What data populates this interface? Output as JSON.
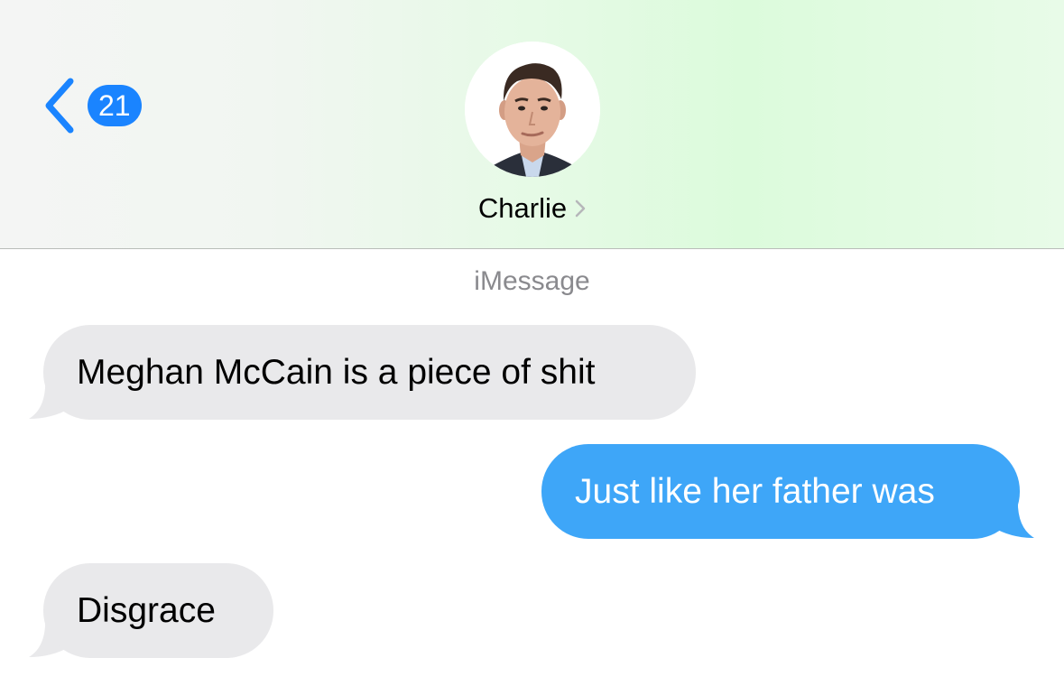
{
  "header": {
    "back_badge_count": "21",
    "contact_name": "Charlie",
    "back_icon": "chevron-left-icon",
    "name_chevron_icon": "chevron-right-icon",
    "background_color": "#eaf8ea"
  },
  "conversation": {
    "service_label": "iMessage",
    "messages": [
      {
        "direction": "incoming",
        "text": "Meghan McCain is a piece of shit"
      },
      {
        "direction": "outgoing",
        "text": "Just like her father was"
      },
      {
        "direction": "incoming",
        "text": "Disgrace"
      }
    ]
  },
  "colors": {
    "accent": "#1a84ff",
    "incoming_bubble": "#e9e9eb",
    "outgoing_bubble": "#3ea6f8",
    "secondary_text": "#8a8a8e"
  }
}
